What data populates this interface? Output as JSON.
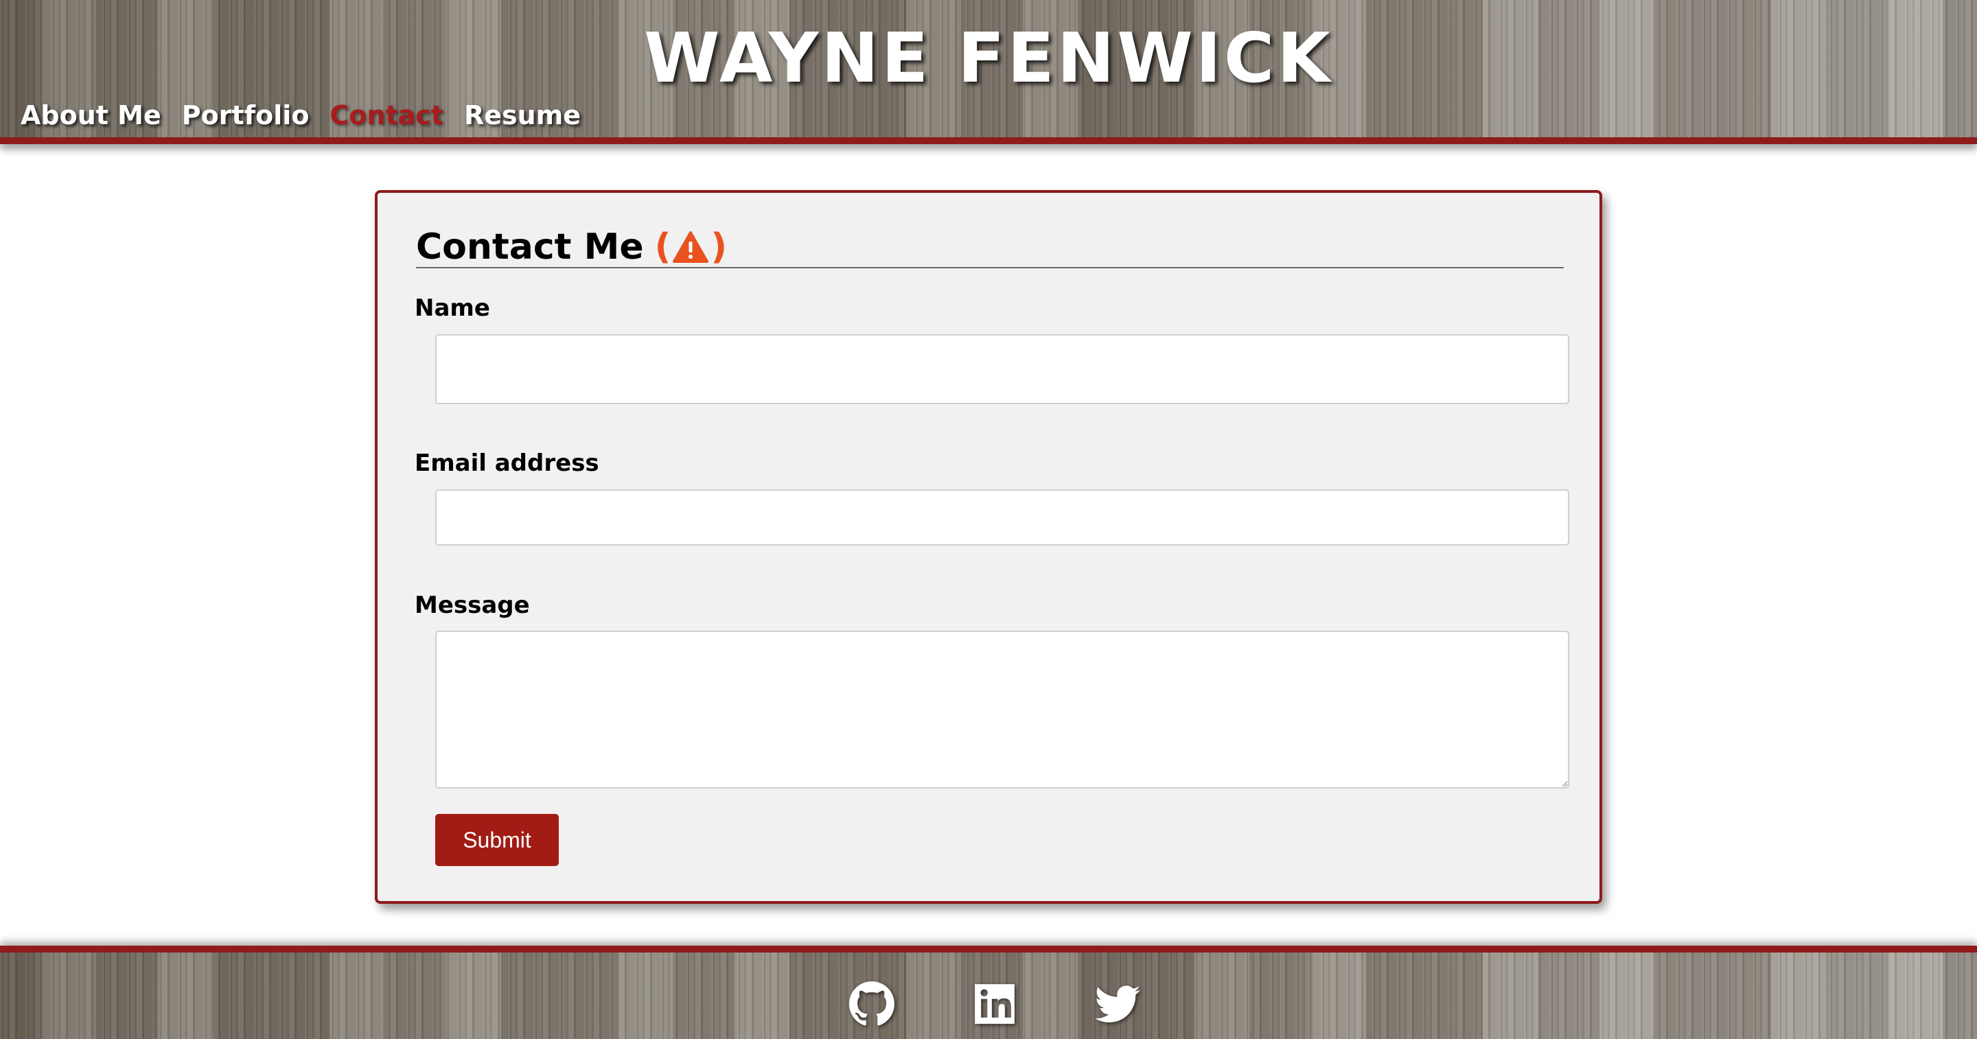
{
  "header": {
    "title": "WAYNE FENWICK",
    "nav": [
      {
        "label": "About Me",
        "active": false
      },
      {
        "label": "Portfolio",
        "active": false
      },
      {
        "label": "Contact",
        "active": true
      },
      {
        "label": "Resume",
        "active": false
      }
    ]
  },
  "contact": {
    "heading": "Contact Me",
    "warning_open": "(",
    "warning_close": ")",
    "warning_icon": "warning-triangle-icon",
    "fields": {
      "name": {
        "label": "Name",
        "value": ""
      },
      "email": {
        "label": "Email address",
        "value": ""
      },
      "message": {
        "label": "Message",
        "value": ""
      }
    },
    "submit_label": "Submit"
  },
  "footer": {
    "icons": [
      "github-icon",
      "linkedin-icon",
      "twitter-icon"
    ]
  },
  "colors": {
    "accent": "#8f1b1b",
    "active_nav": "#a81c1c",
    "warning": "#e8531f",
    "button": "#a01c14",
    "card_bg": "#f1f1f1"
  }
}
